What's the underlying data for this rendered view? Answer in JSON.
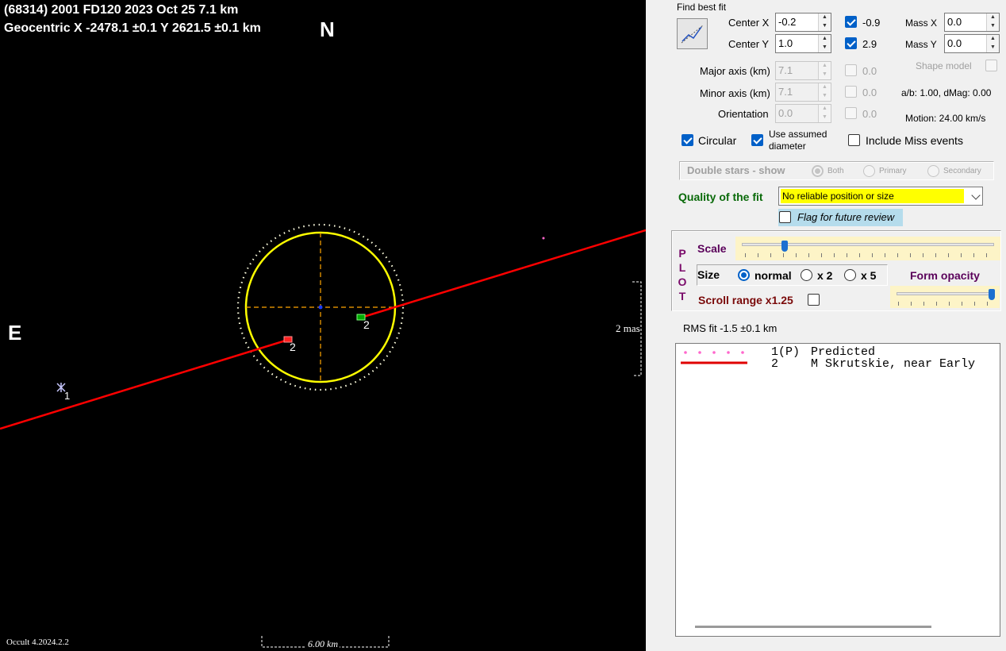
{
  "plot": {
    "title_line1": "(68314) 2001 FD120  2023 Oct 25   7.1 km",
    "title_line2": "Geocentric  X  -2478.1 ±0.1  Y 2621.5 ±0.1 km",
    "north_label": "N",
    "east_label": "E",
    "version": "Occult 4.2024.2.2",
    "scale_bar_label": "6.00 km",
    "mas_label": "2 mas",
    "chord_label_red": "2",
    "chord_label_green": "2",
    "star_label": "1",
    "colors": {
      "background": "#000000",
      "ellipse": "#ffff00",
      "chord": "#ff0000",
      "axes": "#ffa500",
      "limit_circle": "#ffffe0",
      "reappear_marker": "#00aa00"
    }
  },
  "panel": {
    "find_best_fit_label": "Find best fit",
    "fit_button_icon": "line-fit-icon",
    "center_x": {
      "label": "Center X",
      "value": "-0.2",
      "check_label": "-0.9",
      "checked": true
    },
    "center_y": {
      "label": "Center Y",
      "value": "1.0",
      "check_label": "2.9",
      "checked": true
    },
    "mass_x": {
      "label": "Mass X",
      "value": "0.0"
    },
    "mass_y": {
      "label": "Mass Y",
      "value": "0.0"
    },
    "major_axis": {
      "label": "Major axis (km)",
      "value": "7.1",
      "check_label": "0.0"
    },
    "minor_axis": {
      "label": "Minor axis (km)",
      "value": "7.1",
      "check_label": "0.0"
    },
    "orientation": {
      "label": "Orientation",
      "value": "0.0",
      "check_label": "0.0"
    },
    "shape_model_label": "Shape model",
    "ab_dmag_text": "a/b: 1.00, dMag: 0.00",
    "motion_text": "Motion: 24.00 km/s",
    "circular_label": "Circular",
    "use_assumed_line1": "Use assumed",
    "use_assumed_line2": "diameter",
    "include_miss_label": "Include Miss events",
    "double_stars": {
      "label": "Double stars - show",
      "options": [
        "Both",
        "Primary",
        "Secondary"
      ]
    },
    "quality_label": "Quality of the fit",
    "quality_value": "No reliable position or size",
    "flag_label": "Flag for future review",
    "plot_group": {
      "side_letters": [
        "P",
        "L",
        "O",
        "T"
      ],
      "scale_label": "Scale",
      "scale_position": 0.17,
      "size_label": "Size",
      "size_options": [
        "normal",
        "x 2",
        "x 5"
      ],
      "form_opacity_label": "Form opacity",
      "opacity_position": 1.0,
      "scroll_range_label": "Scroll range x1.25"
    },
    "rms_text": "RMS fit -1.5 ±0.1 km",
    "legend": [
      {
        "id": "1(P)",
        "text": "Predicted",
        "style": "dots",
        "color": "#ff66cc"
      },
      {
        "id": "2",
        "text": "M Skrutskie, near Early",
        "style": "line",
        "color": "#e00000"
      }
    ]
  }
}
